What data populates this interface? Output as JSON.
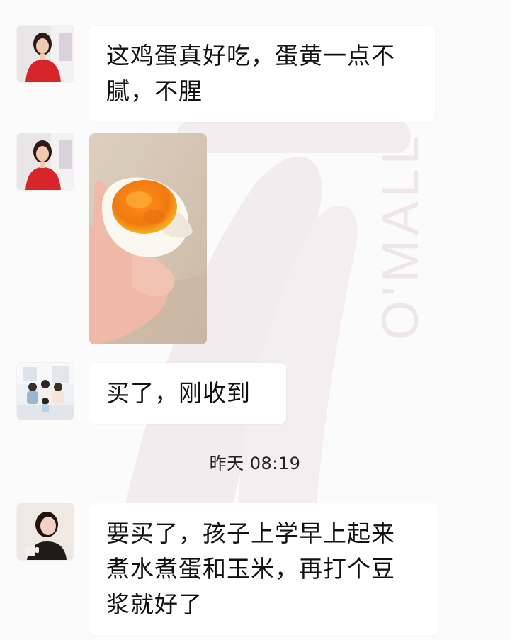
{
  "messages": [
    {
      "text": "这鸡蛋真好吃，蛋黄一点不\n腻，不腥"
    },
    {
      "image_alt": "egg-photo"
    },
    {
      "text": "买了，刚收到"
    },
    {
      "text": "要买了，孩子上学早上起来\n煮水煮蛋和玉米，再打个豆\n浆就好了"
    }
  ],
  "timestamp": "昨天 08:19",
  "watermark": {
    "text": "O'MALL",
    "color": "#efe3ea"
  },
  "colors": {
    "background": "#fbfbfb",
    "bubble": "#ffffff"
  }
}
